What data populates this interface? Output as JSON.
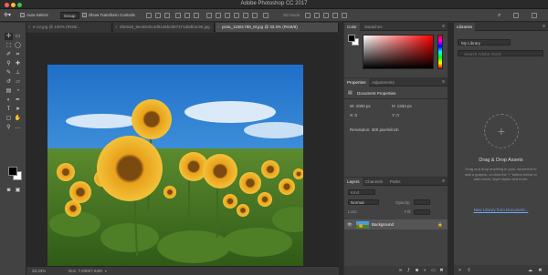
{
  "app": {
    "title": "Adobe Photoshop CC 2017"
  },
  "options_bar": {
    "auto_select_label": "Auto-Select:",
    "auto_select_value": "Group",
    "transform_controls_label": "Show Transform Controls",
    "mode_label": "3D Mode:"
  },
  "tabs": [
    {
      "label": "e-12.jpg @ 100% (RGB/..."
    },
    {
      "label": "2be648_9ec65c9c4d9146bc867371d8db4c96.jpg"
    },
    {
      "label": "pixta_11561788_M.jpg @ 33.3% (RGB/8)"
    }
  ],
  "status": {
    "zoom": "33.33%",
    "doc": "Doc: 7.63M/7.63M"
  },
  "color_panel": {
    "tabs": [
      "Color",
      "Swatches"
    ]
  },
  "properties_panel": {
    "tabs": [
      "Properties",
      "Adjustments"
    ],
    "heading": "Document Properties",
    "width": "W: 2000 px",
    "height": "H: 1333 px",
    "x": "X: 0",
    "y": "Y: 0",
    "resolution": "Resolution: 300 pixels/inch"
  },
  "layers_panel": {
    "tabs": [
      "Layers",
      "Channels",
      "Paths"
    ],
    "kind_placeholder": "Kind",
    "blend_mode": "Normal",
    "opacity_label": "Opacity:",
    "lock_label": "Lock:",
    "fill_label": "Fill:",
    "layer_name": "Background"
  },
  "libraries_panel": {
    "title": "Libraries",
    "library_select": "My Library",
    "search_placeholder": "Search Adobe Stock",
    "drag_title": "Drag & Drop Assets",
    "drag_text": "Drag and drop anything in your document to add a graphic, or click the '+' button below to add colors, layer styles and more.",
    "new_library_link": "New Library from Document..."
  },
  "colors": {
    "sky": "#3f8fd6",
    "accent": "#3d7ef0",
    "sunflower": "#e9a019"
  }
}
